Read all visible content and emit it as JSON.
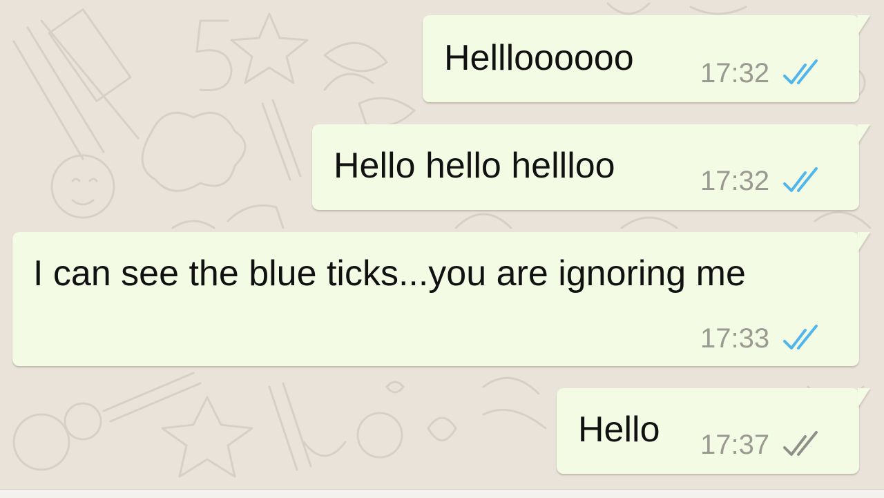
{
  "colors": {
    "background": "#e9e3da",
    "bubble": "#f3fbe4",
    "read_ticks": "#4fb6ec",
    "delivered_ticks": "#8f8f8a",
    "timestamp": "#9a9a92"
  },
  "messages": [
    {
      "text": "Hellloooooo",
      "time": "17:32",
      "status_icon": "double-check-read-icon"
    },
    {
      "text": "Hello hello hellloo",
      "time": "17:32",
      "status_icon": "double-check-read-icon"
    },
    {
      "text": "I can see the blue ticks...you are ignoring me",
      "time": "17:33",
      "status_icon": "double-check-read-icon"
    },
    {
      "text": "Hello",
      "time": "17:37",
      "status_icon": "double-check-delivered-icon"
    }
  ]
}
